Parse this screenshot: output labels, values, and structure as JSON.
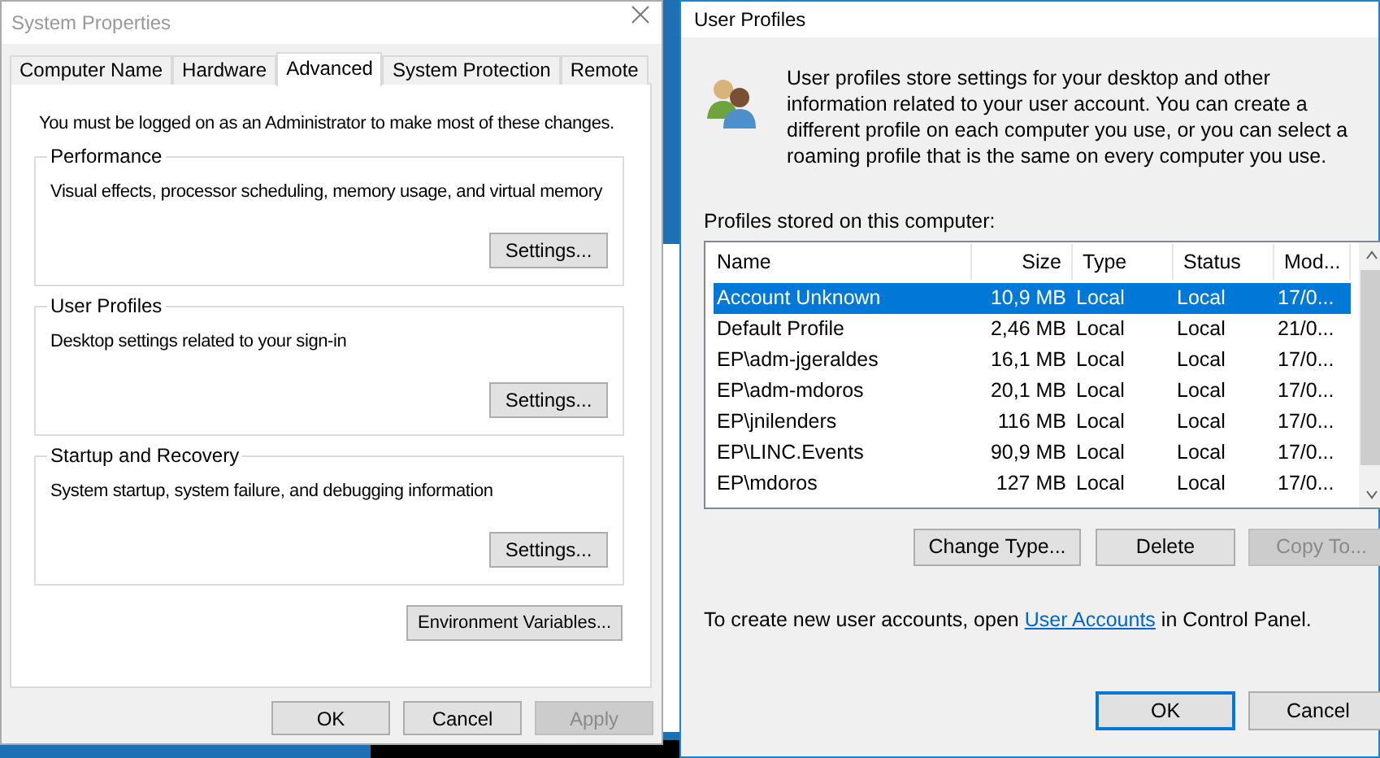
{
  "system_properties": {
    "title": "System Properties",
    "tabs": [
      {
        "label": "Computer Name",
        "selected": false
      },
      {
        "label": "Hardware",
        "selected": false
      },
      {
        "label": "Advanced",
        "selected": true
      },
      {
        "label": "System Protection",
        "selected": false
      },
      {
        "label": "Remote",
        "selected": false
      }
    ],
    "notice": "You must be logged on as an Administrator to make most of these changes.",
    "groups": [
      {
        "title": "Performance",
        "description": "Visual effects, processor scheduling, memory usage, and virtual memory",
        "button": "Settings..."
      },
      {
        "title": "User Profiles",
        "description": "Desktop settings related to your sign-in",
        "button": "Settings..."
      },
      {
        "title": "Startup and Recovery",
        "description": "System startup, system failure, and debugging information",
        "button": "Settings..."
      }
    ],
    "env_button": "Environment Variables...",
    "buttons": [
      {
        "label": "OK",
        "disabled": false
      },
      {
        "label": "Cancel",
        "disabled": false
      },
      {
        "label": "Apply",
        "disabled": true
      }
    ]
  },
  "user_profiles": {
    "title": "User Profiles",
    "intro": "User profiles store settings for your desktop and other information related to your user account. You can create a different profile on each computer you use, or you can select a roaming profile that is the same on every computer you use.",
    "list_label": "Profiles stored on this computer:",
    "table": {
      "columns": [
        "Name",
        "Size",
        "Type",
        "Status",
        "Mod..."
      ],
      "rows": [
        {
          "name": "Account Unknown",
          "size": "10,9 MB",
          "type": "Local",
          "status": "Local",
          "modified": "17/0...",
          "selected": true
        },
        {
          "name": "Default Profile",
          "size": "2,46 MB",
          "type": "Local",
          "status": "Local",
          "modified": "21/0...",
          "selected": false
        },
        {
          "name": "EP\\adm-jgeraldes",
          "size": "16,1 MB",
          "type": "Local",
          "status": "Local",
          "modified": "17/0...",
          "selected": false
        },
        {
          "name": "EP\\adm-mdoros",
          "size": "20,1 MB",
          "type": "Local",
          "status": "Local",
          "modified": "17/0...",
          "selected": false
        },
        {
          "name": "EP\\jnilenders",
          "size": "116 MB",
          "type": "Local",
          "status": "Local",
          "modified": "17/0...",
          "selected": false
        },
        {
          "name": "EP\\LINC.Events",
          "size": "90,9 MB",
          "type": "Local",
          "status": "Local",
          "modified": "17/0...",
          "selected": false
        },
        {
          "name": "EP\\mdoros",
          "size": "127 MB",
          "type": "Local",
          "status": "Local",
          "modified": "17/0...",
          "selected": false
        }
      ]
    },
    "action_buttons": [
      {
        "label": "Change Type...",
        "disabled": false
      },
      {
        "label": "Delete",
        "disabled": false
      },
      {
        "label": "Copy To...",
        "disabled": true
      }
    ],
    "footer_before": "To create new user accounts, open",
    "footer_link": "User Accounts",
    "footer_after": "in Control Panel.",
    "buttons": [
      {
        "label": "OK",
        "focused": true
      },
      {
        "label": "Cancel",
        "focused": false
      }
    ]
  }
}
